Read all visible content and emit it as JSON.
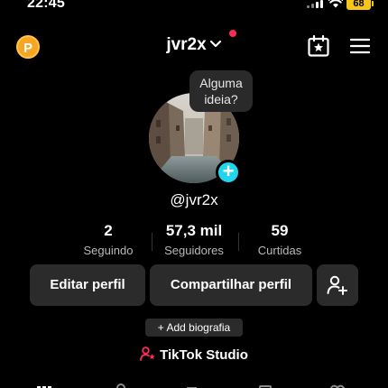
{
  "status_bar": {
    "time": "22:45",
    "battery": "68"
  },
  "header": {
    "username": "jvr2x",
    "coin_label": "P"
  },
  "tooltip": {
    "line1": "Alguma",
    "line2": "ideia?"
  },
  "profile": {
    "handle": "@jvr2x"
  },
  "stats": [
    {
      "value": "2",
      "label": "Seguindo"
    },
    {
      "value": "57,3 mil",
      "label": "Seguidores"
    },
    {
      "value": "59",
      "label": "Curtidas"
    }
  ],
  "buttons": {
    "edit": "Editar perfil",
    "share": "Compartilhar perfil",
    "bio": "+ Add biografia"
  },
  "studio": {
    "label": "TikTok Studio"
  },
  "colors": {
    "accent_red": "#fe2c55",
    "accent_cyan": "#20d5ec",
    "coin_orange": "#f5a623",
    "battery_yellow": "#f5c518"
  }
}
